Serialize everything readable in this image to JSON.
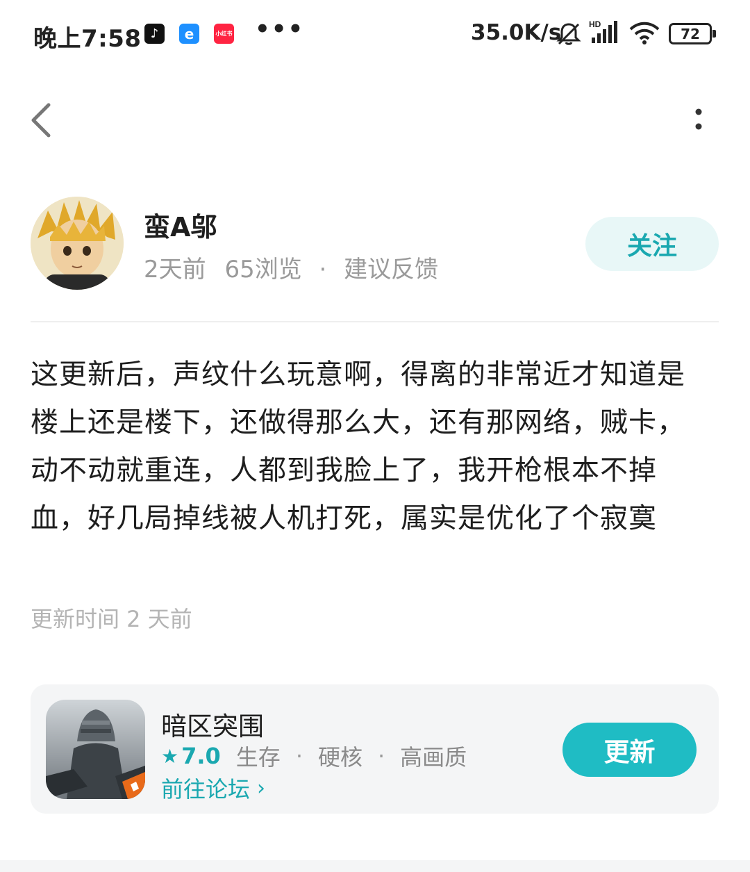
{
  "status_bar": {
    "time": "晚上7:58",
    "apps": [
      {
        "icon": "tiktok-icon",
        "label": "♪",
        "color": "#111111"
      },
      {
        "icon": "eleme-icon",
        "label": "e",
        "color": "#1e90ff"
      },
      {
        "icon": "xiaohongshu-icon",
        "label": "小红书",
        "color": "#ff2442"
      }
    ],
    "more": "•••",
    "net_speed": "35.0K/s",
    "battery": "72"
  },
  "nav": {
    "back_icon": "chevron-left-icon",
    "more_icon": "more-vertical-icon"
  },
  "author": {
    "name": "蛮A邬",
    "time": "2天前",
    "views": "65浏览",
    "dot": "·",
    "category": "建议反馈",
    "follow_label": "关注"
  },
  "post": {
    "lines": [
      "这更新后，声纹什么玩意啊，得离的非常近才知道是",
      "楼上还是楼下，还做得那么大，还有那网络，贼卡，",
      "动不动就重连，人都到我脸上了，我开枪根本不掉",
      "血，好几局掉线被人机打死，属实是优化了个寂寞"
    ],
    "update_time": "更新时间 2 天前"
  },
  "game": {
    "name": "暗区突围",
    "star": "★",
    "score": "7.0",
    "tags": [
      "生存",
      "硬核",
      "高画质"
    ],
    "sep": "·",
    "forum_label": "前往论坛",
    "forum_chevron": "›",
    "update_label": "更新"
  },
  "colors": {
    "accent": "#1fbcc4",
    "accent_text": "#1aa8b0",
    "follow_bg": "#e8f7f7",
    "card_bg": "#f4f5f6"
  }
}
